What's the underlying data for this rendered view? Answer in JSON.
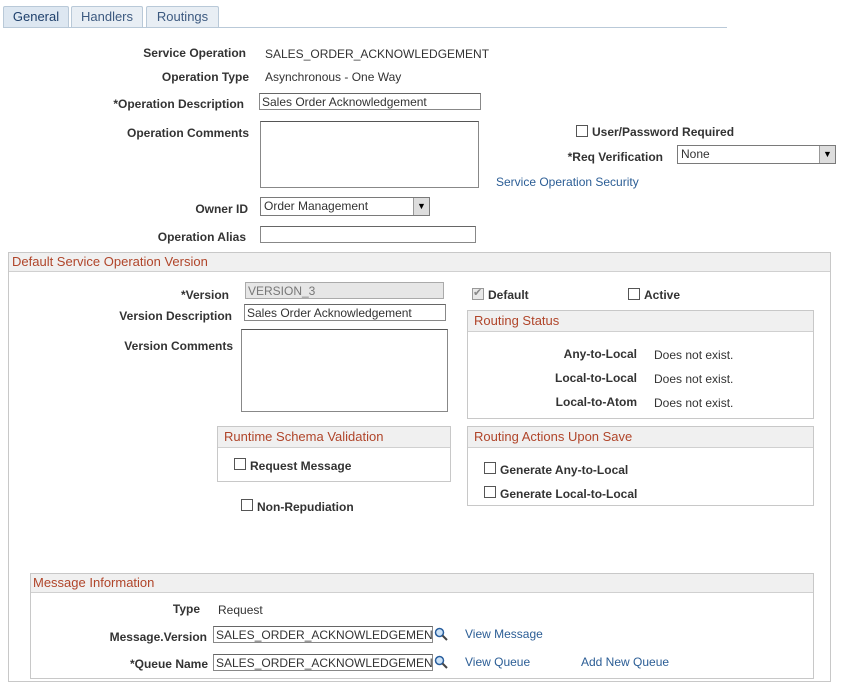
{
  "tabs": [
    {
      "label": "General",
      "active": true
    },
    {
      "label": "Handlers",
      "active": false
    },
    {
      "label": "Routings",
      "active": false
    }
  ],
  "form": {
    "service_operation_label": "Service Operation",
    "service_operation_value": "SALES_ORDER_ACKNOWLEDGEMENT",
    "operation_type_label": "Operation Type",
    "operation_type_value": "Asynchronous - One Way",
    "operation_description_label": "*Operation Description",
    "operation_description_value": "Sales Order Acknowledgement",
    "operation_comments_label": "Operation Comments",
    "user_password_label": "User/Password Required",
    "req_verification_label": "*Req Verification",
    "req_verification_value": "None",
    "service_operation_security_link": "Service Operation Security",
    "owner_id_label": "Owner ID",
    "owner_id_value": "Order Management",
    "operation_alias_label": "Operation Alias",
    "operation_alias_value": ""
  },
  "version_section": {
    "title": "Default Service Operation Version",
    "version_label": "*Version",
    "version_value": "VERSION_3",
    "default_label": "Default",
    "default_checked": true,
    "active_label": "Active",
    "active_checked": false,
    "version_description_label": "Version Description",
    "version_description_value": "Sales Order Acknowledgement",
    "version_comments_label": "Version Comments",
    "routing_status": {
      "title": "Routing Status",
      "rows": [
        {
          "label": "Any-to-Local",
          "value": "Does not exist."
        },
        {
          "label": "Local-to-Local",
          "value": "Does not exist."
        },
        {
          "label": "Local-to-Atom",
          "value": "Does not exist."
        }
      ]
    },
    "runtime_schema": {
      "title": "Runtime Schema Validation",
      "request_message_label": "Request Message"
    },
    "routing_actions": {
      "title": "Routing Actions Upon Save",
      "generate_any_label": "Generate Any-to-Local",
      "generate_local_label": "Generate Local-to-Local"
    },
    "non_repudiation_label": "Non-Repudiation"
  },
  "message_info": {
    "title": "Message Information",
    "type_label": "Type",
    "type_value": "Request",
    "message_version_label": "Message.Version",
    "message_version_value": "SALES_ORDER_ACKNOWLEDGEMENT",
    "view_message_link": "View Message",
    "queue_name_label": "*Queue Name",
    "queue_name_value": "SALES_ORDER_ACKNOWLEDGEMENT",
    "view_queue_link": "View Queue",
    "add_new_queue_link": "Add New Queue"
  },
  "colors": {
    "section_title": "#b0452a",
    "link": "#2b5d95",
    "tab_bg": "#e8eef4"
  },
  "icons": {
    "lookup": "magnifier-icon",
    "dropdown": "dropdown-arrow-icon"
  }
}
